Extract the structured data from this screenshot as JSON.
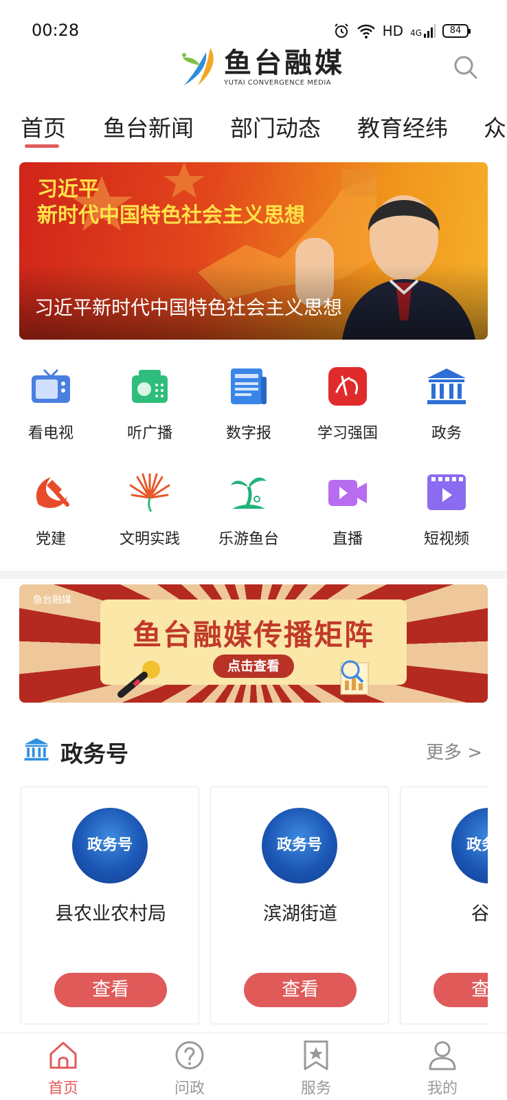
{
  "status_bar": {
    "time": "00:28",
    "network": "HD",
    "signal": "4G",
    "battery": "84"
  },
  "header": {
    "logo_cn": "鱼台融媒",
    "logo_en": "YUTAI CONVERGENCE MEDIA",
    "search_icon": "search-icon"
  },
  "tabs": [
    {
      "label": "首页",
      "active": true
    },
    {
      "label": "鱼台新闻"
    },
    {
      "label": "部门动态"
    },
    {
      "label": "教育经纬"
    },
    {
      "label": "众"
    }
  ],
  "hero": {
    "title_line1": "习近平",
    "title_line2": "新时代中国特色社会主义思想",
    "caption": "习近平新时代中国特色社会主义思想"
  },
  "grid": [
    {
      "label": "看电视",
      "icon": "tv-icon",
      "color": "#4a7fe0"
    },
    {
      "label": "听广播",
      "icon": "radio-icon",
      "color": "#2ebd7a"
    },
    {
      "label": "数字报",
      "icon": "newspaper-icon",
      "color": "#3a86e8"
    },
    {
      "label": "学习强国",
      "icon": "xuexi-icon",
      "color": "#e02b2b"
    },
    {
      "label": "政务",
      "icon": "government-icon",
      "color": "#2f6fd6"
    },
    {
      "label": "党建",
      "icon": "party-icon",
      "color": "#e84b2a"
    },
    {
      "label": "文明实践",
      "icon": "civilization-icon",
      "color": "#e8572a"
    },
    {
      "label": "乐游鱼台",
      "icon": "palm-tree-icon",
      "color": "#22b37a"
    },
    {
      "label": "直播",
      "icon": "live-video-icon",
      "color": "#b86cf0"
    },
    {
      "label": "短视频",
      "icon": "short-video-icon",
      "color": "#8b6cf0"
    }
  ],
  "promo": {
    "logo": "鱼台融媒",
    "title": "鱼台融媒传播矩阵",
    "button": "点击查看"
  },
  "section": {
    "icon": "government-icon",
    "title": "政务号",
    "more": "更多 >"
  },
  "cards": [
    {
      "badge": "政务号",
      "name": "县农业农村局",
      "button": "查看"
    },
    {
      "badge": "政务号",
      "name": "滨湖街道",
      "button": "查看"
    },
    {
      "badge": "政务号",
      "name": "谷亭",
      "button": "查看"
    }
  ],
  "bottom_nav": [
    {
      "label": "首页",
      "icon": "home-icon",
      "active": true
    },
    {
      "label": "问政",
      "icon": "question-icon"
    },
    {
      "label": "服务",
      "icon": "bookmark-star-icon"
    },
    {
      "label": "我的",
      "icon": "user-icon"
    }
  ],
  "colors": {
    "accent": "#e05a5a",
    "inactive_nav": "#999999"
  }
}
